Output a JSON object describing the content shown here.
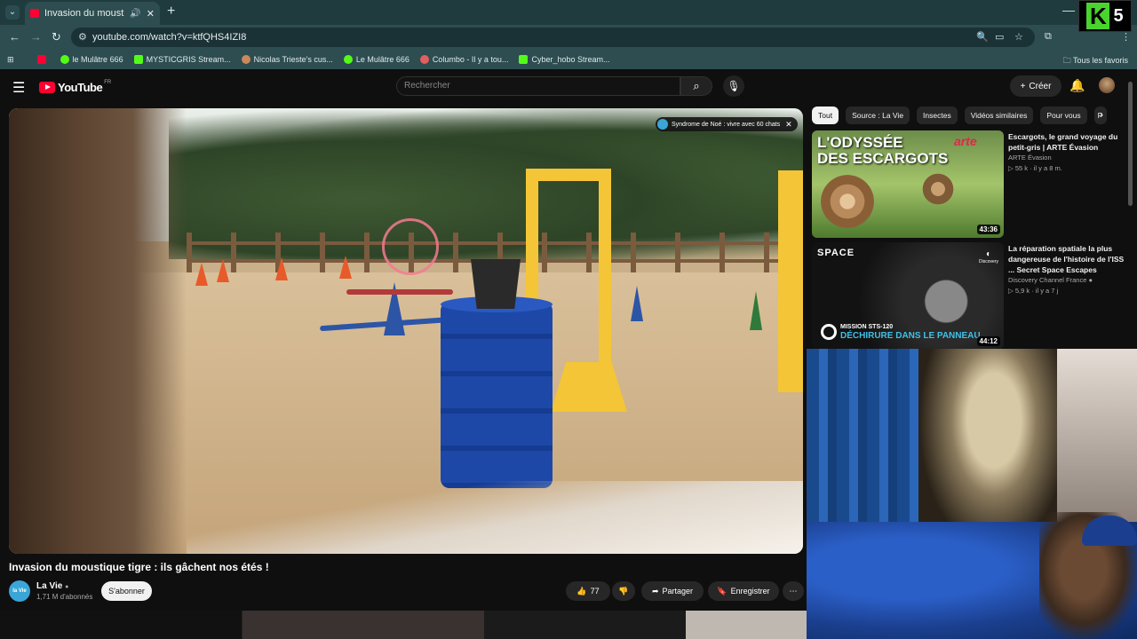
{
  "browser": {
    "tab_title": "Invasion du moustique tigre",
    "url": "youtube.com/watch?v=ktfQHS4IZI8",
    "bookmarks": [
      {
        "label": "",
        "color": "#ff0033"
      },
      {
        "label": "le Mulâtre 666",
        "color": "#53fc18"
      },
      {
        "label": "MYSTICGRIS Stream...",
        "color": "#53fc18"
      },
      {
        "label": "Nicolas Trieste's cus...",
        "color": "#c88a5a"
      },
      {
        "label": "Le Mulâtre 666",
        "color": "#53fc18"
      },
      {
        "label": "Columbo - Il y a tou...",
        "color": "#e06060"
      },
      {
        "label": "Cyber_hobo Stream...",
        "color": "#53fc18"
      }
    ],
    "all_favorites": "Tous les favoris"
  },
  "overlay": {
    "badge_letter": "K",
    "badge_number": "5"
  },
  "youtube": {
    "logo_text": "YouTube",
    "region": "FR",
    "search_placeholder": "Rechercher",
    "create_label": "Créer",
    "video": {
      "title": "Invasion du moustique tigre : ils gâchent nos étés !",
      "channel": "La Vie",
      "subscribers": "1,71 M d'abonnés",
      "subscribe_label": "S'abonner",
      "likes": "77",
      "share_label": "Partager",
      "save_label": "Enregistrer",
      "info_chip": "Syndrome de Noé : vivre avec 60 chats",
      "channel_avatar_text": "la Vie"
    },
    "filter_chips": [
      "Tout",
      "Source : La Vie",
      "Insectes",
      "Vidéos similaires",
      "Pour vous",
      "P"
    ],
    "recommendations": [
      {
        "title": "Escargots, le grand voyage du petit-gris | ARTE Évasion",
        "channel": "ARTE Évasion",
        "meta": "55 k · il y a 8 m.",
        "duration": "43:36",
        "thumb_text_1": "L'ODYSSÉE",
        "thumb_text_2": "DES ESCARGOTS",
        "thumb_brand": "arte"
      },
      {
        "title": "La réparation spatiale la plus dangereuse de l'histoire de l'ISS ... Secret Space Escapes",
        "channel": "Discovery Channel France",
        "meta": "5,9 k · il y a 7 j",
        "duration": "44:12",
        "thumb_text_1": "SPACE",
        "thumb_text_2": "MISSION STS-120",
        "thumb_text_3": "DÉCHIRURE DANS LE PANNEAU",
        "thumb_brand": "Discovery"
      }
    ]
  },
  "colors": {
    "accent": "#ff0033",
    "chrome": "#2d4d51",
    "kick_green": "#4ad22e"
  }
}
